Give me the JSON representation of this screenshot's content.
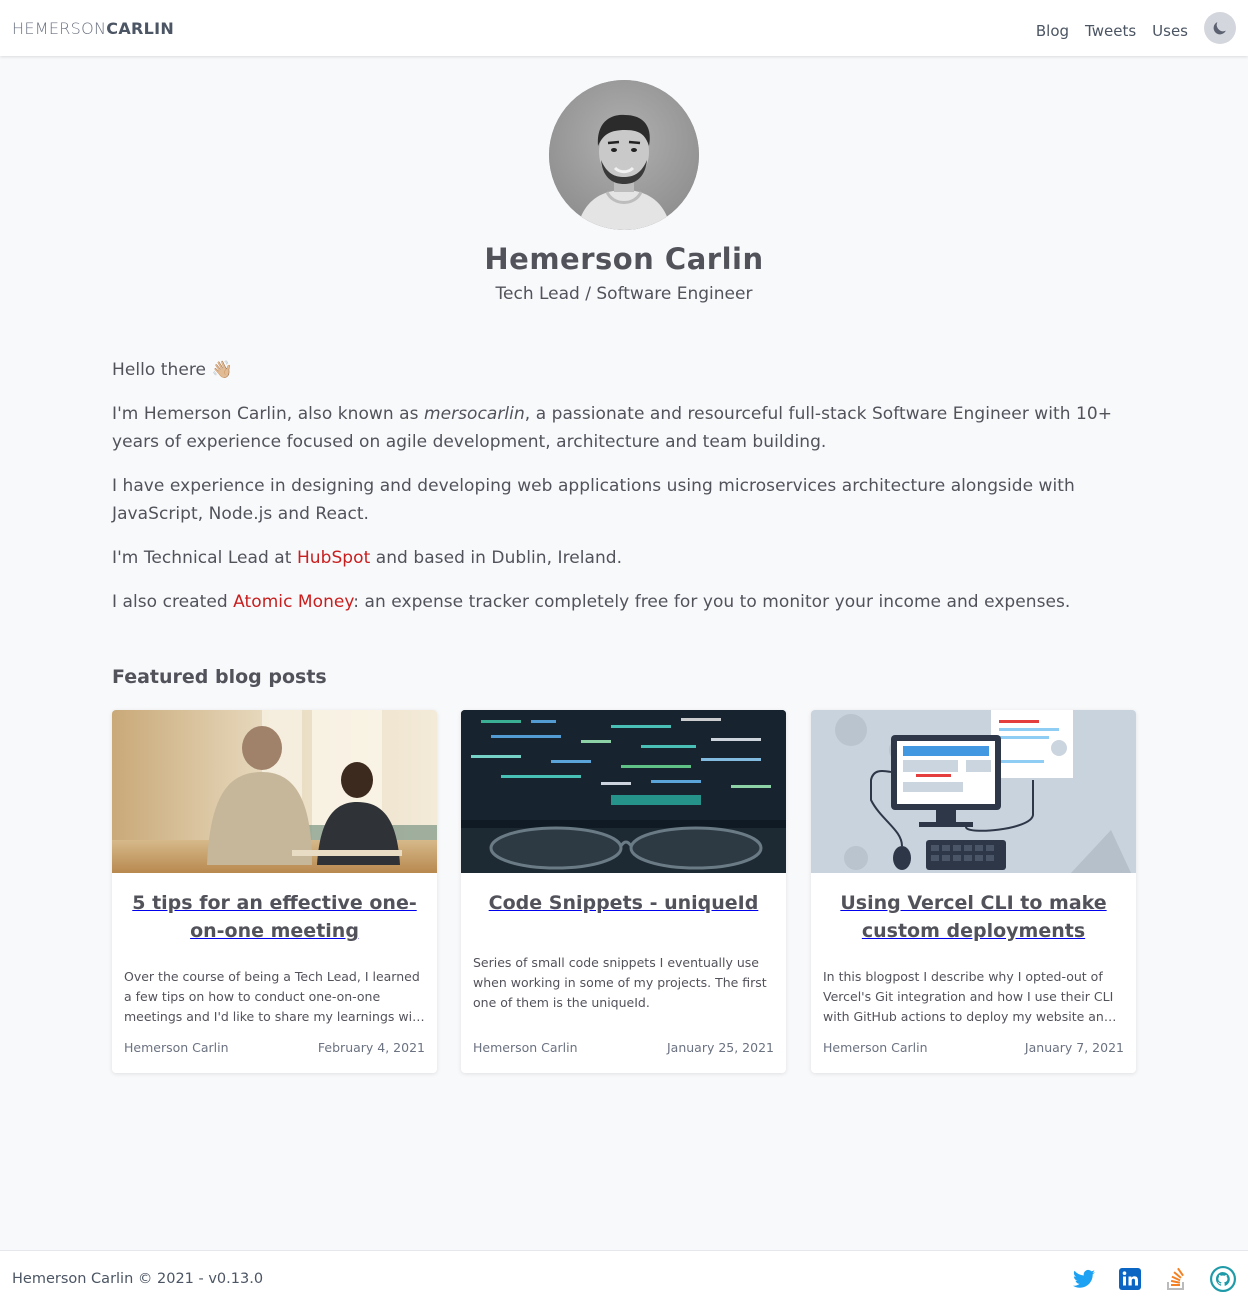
{
  "header": {
    "logo_light": "HEMERSON",
    "logo_bold": "CARLIN",
    "nav": [
      {
        "label": "Blog"
      },
      {
        "label": "Tweets"
      },
      {
        "label": "Uses"
      }
    ],
    "theme_icon": "moon-icon"
  },
  "hero": {
    "name": "Hemerson Carlin",
    "role": "Tech Lead / Software Engineer"
  },
  "about": {
    "greeting": "Hello there 👋🏼",
    "p1_pre": "I'm Hemerson Carlin, also known as ",
    "p1_nick": "mersocarlin",
    "p1_post": ", a passionate and resourceful full-stack Software Engineer with 10+ years of experience focused on agile development, architecture and team building.",
    "p2": "I have experience in designing and developing web applications using microservices architecture alongside with JavaScript, Node.js and React.",
    "p3_pre": "I'm Technical Lead at ",
    "p3_link": "HubSpot",
    "p3_post": " and based in Dublin, Ireland.",
    "p4_pre": "I also created ",
    "p4_link": "Atomic Money",
    "p4_post": ": an expense tracker completely free for you to monitor your income and expenses."
  },
  "featured": {
    "title": "Featured blog posts",
    "posts": [
      {
        "title": "5 tips for an effective one-on-one meeting",
        "description": "Over the course of being a Tech Lead, I learned a few tips on how to conduct one-on-one meetings and I'd like to share my learnings with you.",
        "author": "Hemerson Carlin",
        "date": "February 4, 2021"
      },
      {
        "title": "Code Snippets - uniqueId",
        "description": "Series of small code snippets I eventually use when working in some of my projects. The first one of them is the uniqueId.",
        "author": "Hemerson Carlin",
        "date": "January 25, 2021"
      },
      {
        "title": "Using Vercel CLI to make custom deployments",
        "description": "In this blogpost I describe why I opted-out of Vercel's Git integration and how I use their CLI with GitHub actions to deploy my website and preview branches.",
        "author": "Hemerson Carlin",
        "date": "January 7, 2021"
      }
    ]
  },
  "footer": {
    "text": "Hemerson Carlin © 2021 - v0.13.0",
    "socials": [
      "twitter-icon",
      "linkedin-icon",
      "stackoverflow-icon",
      "github-icon"
    ]
  },
  "colors": {
    "accent_link": "#c81e1e",
    "text": "#52525b",
    "background": "#f8f9fb",
    "twitter": "#1da1f2",
    "linkedin": "#0a66c2",
    "stackoverflow": "#f48024",
    "github": "#1f9aa8"
  }
}
